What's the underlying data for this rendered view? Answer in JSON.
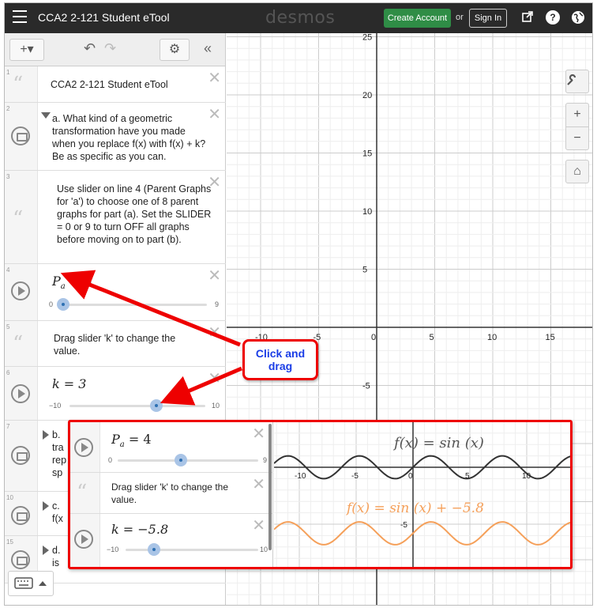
{
  "topbar": {
    "title": "CCA2 2-121 Student eTool",
    "brand": "desmos",
    "create_account": "Create Account",
    "or": "or",
    "sign_in": "Sign In",
    "help_glyph": "?"
  },
  "panel": {
    "items": [
      {
        "num": "1",
        "text": "CCA2 2-121 Student eTool"
      },
      {
        "num": "2",
        "text": "a. What kind of a geometric transformation have you made when you replace f(x) with f(x) + k? Be as specific as you can."
      },
      {
        "num": "3",
        "text": "Use slider on line 4 (Parent Graphs for 'a') to choose one of 8 parent graphs for part (a). Set the SLIDER = 0 or 9 to turn OFF all graphs before moving on to part (b)."
      },
      {
        "num": "4",
        "var": "P",
        "sub": "a",
        "rest": " = 0",
        "min": "0",
        "max": "9"
      },
      {
        "num": "5",
        "text": "Drag slider 'k' to change the value."
      },
      {
        "num": "6",
        "expr": "k = 3",
        "min": "−10",
        "max": "10"
      },
      {
        "num": "7",
        "text": "b."
      },
      {
        "num": "10",
        "text": "c."
      },
      {
        "num": "15",
        "text": "d."
      }
    ],
    "partial": {
      "b_lines": [
        "tra",
        "rep",
        "sp"
      ],
      "c_line": "f(x",
      "d_line": "is"
    }
  },
  "callout": {
    "line1": "Click and",
    "line2": "drag"
  },
  "inset": {
    "expr1": {
      "var": "P",
      "sub": "a",
      "rest": " = 4",
      "min": "0",
      "max": "9"
    },
    "expr2": "Drag slider 'k' to change the value.",
    "expr3": {
      "expr": "k = −5.8",
      "min": "−10",
      "max": "10"
    },
    "label_top": "f(x) = sin (x)",
    "label_bottom": "f(x) = sin (x) + −5.8",
    "ticks_x": [
      "-10",
      "-5",
      "0",
      "5",
      "10"
    ],
    "tick_y": "-5"
  },
  "graph": {
    "x_ticks": [
      "-10",
      "-5",
      "0",
      "5",
      "10",
      "15"
    ],
    "y_ticks": [
      "25",
      "20",
      "15",
      "10",
      "5",
      "-5"
    ]
  },
  "colors": {
    "accent_green": "#2f8d46",
    "callout_red": "#e00000",
    "callout_text": "#1a3de6",
    "curve_dark": "#333333",
    "curve_orange": "#f5a05a"
  },
  "icons": [
    "hamburger-icon",
    "share-icon",
    "help-icon",
    "globe-icon",
    "plus-icon",
    "undo-icon",
    "redo-icon",
    "gear-icon",
    "collapse-icon",
    "wrench-icon",
    "zoom-in-icon",
    "zoom-out-icon",
    "home-icon",
    "keyboard-icon"
  ]
}
